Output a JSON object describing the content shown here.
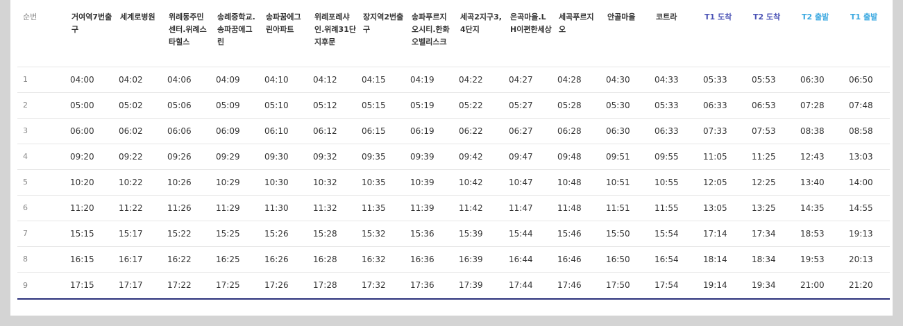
{
  "table": {
    "headers": [
      "순번",
      "거여역7번출구",
      "세계로병원",
      "위례동주민센터.위례스타힐스",
      "송례중학교.송파꿈에그린",
      "송파꿈에그린아파트",
      "위례포레샤인.위례31단지후문",
      "장지역2번출구",
      "송파푸르지오시티.한화오벨리스크",
      "세곡2지구3,4단지",
      "은곡마을.LH이편한세상",
      "세곡푸르지오",
      "안골마을",
      "코트라",
      "T1 도착",
      "T2 도착",
      "T2 출발",
      "T1 출발"
    ],
    "header_colors": {
      "t1_arrive": "#4a52b5",
      "t2_arrive": "#4a52b5",
      "t2_depart": "#3aa8e0",
      "t1_depart": "#3aa8e0",
      "bottom_rule": "#2a2f7a"
    },
    "rows": [
      [
        "1",
        "04:00",
        "04:02",
        "04:06",
        "04:09",
        "04:10",
        "04:12",
        "04:15",
        "04:19",
        "04:22",
        "04:27",
        "04:28",
        "04:30",
        "04:33",
        "05:33",
        "05:53",
        "06:30",
        "06:50"
      ],
      [
        "2",
        "05:00",
        "05:02",
        "05:06",
        "05:09",
        "05:10",
        "05:12",
        "05:15",
        "05:19",
        "05:22",
        "05:27",
        "05:28",
        "05:30",
        "05:33",
        "06:33",
        "06:53",
        "07:28",
        "07:48"
      ],
      [
        "3",
        "06:00",
        "06:02",
        "06:06",
        "06:09",
        "06:10",
        "06:12",
        "06:15",
        "06:19",
        "06:22",
        "06:27",
        "06:28",
        "06:30",
        "06:33",
        "07:33",
        "07:53",
        "08:38",
        "08:58"
      ],
      [
        "4",
        "09:20",
        "09:22",
        "09:26",
        "09:29",
        "09:30",
        "09:32",
        "09:35",
        "09:39",
        "09:42",
        "09:47",
        "09:48",
        "09:51",
        "09:55",
        "11:05",
        "11:25",
        "12:43",
        "13:03"
      ],
      [
        "5",
        "10:20",
        "10:22",
        "10:26",
        "10:29",
        "10:30",
        "10:32",
        "10:35",
        "10:39",
        "10:42",
        "10:47",
        "10:48",
        "10:51",
        "10:55",
        "12:05",
        "12:25",
        "13:40",
        "14:00"
      ],
      [
        "6",
        "11:20",
        "11:22",
        "11:26",
        "11:29",
        "11:30",
        "11:32",
        "11:35",
        "11:39",
        "11:42",
        "11:47",
        "11:48",
        "11:51",
        "11:55",
        "13:05",
        "13:25",
        "14:35",
        "14:55"
      ],
      [
        "7",
        "15:15",
        "15:17",
        "15:22",
        "15:25",
        "15:26",
        "15:28",
        "15:32",
        "15:36",
        "15:39",
        "15:44",
        "15:46",
        "15:50",
        "15:54",
        "17:14",
        "17:34",
        "18:53",
        "19:13"
      ],
      [
        "8",
        "16:15",
        "16:17",
        "16:22",
        "16:25",
        "16:26",
        "16:28",
        "16:32",
        "16:36",
        "16:39",
        "16:44",
        "16:46",
        "16:50",
        "16:54",
        "18:14",
        "18:34",
        "19:53",
        "20:13"
      ],
      [
        "9",
        "17:15",
        "17:17",
        "17:22",
        "17:25",
        "17:26",
        "17:28",
        "17:32",
        "17:36",
        "17:39",
        "17:44",
        "17:46",
        "17:50",
        "17:54",
        "19:14",
        "19:34",
        "21:00",
        "21:20"
      ]
    ]
  }
}
